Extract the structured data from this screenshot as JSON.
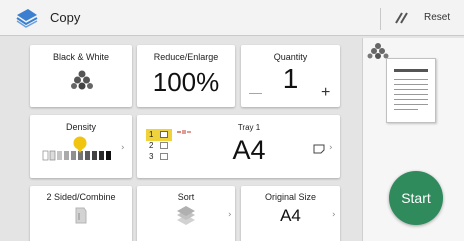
{
  "header": {
    "title": "Copy",
    "reset_label": "Reset",
    "app_icon": "copy-app-icon",
    "reset_icon": "reset-icon"
  },
  "tiles": {
    "color_mode": {
      "label": "Black & White",
      "icon": "black-white-icon"
    },
    "reduce_enlarge": {
      "label": "Reduce/Enlarge",
      "value": "100%"
    },
    "quantity": {
      "label": "Quantity",
      "value": "1",
      "minus": "—",
      "plus": "+"
    },
    "density": {
      "label": "Density"
    },
    "paper": {
      "tray": "Tray 1",
      "size": "A4",
      "tray_numbers": [
        "1",
        "2",
        "3"
      ]
    },
    "duplex": {
      "label": "2 Sided/Combine"
    },
    "sort": {
      "label": "Sort"
    },
    "original_size": {
      "label": "Original Size",
      "value": "A4"
    }
  },
  "start_label": "Start",
  "colors": {
    "start": "#2f8a5c",
    "tray_highlight": "#f0d33a",
    "density_knob": "#f1c40f"
  }
}
